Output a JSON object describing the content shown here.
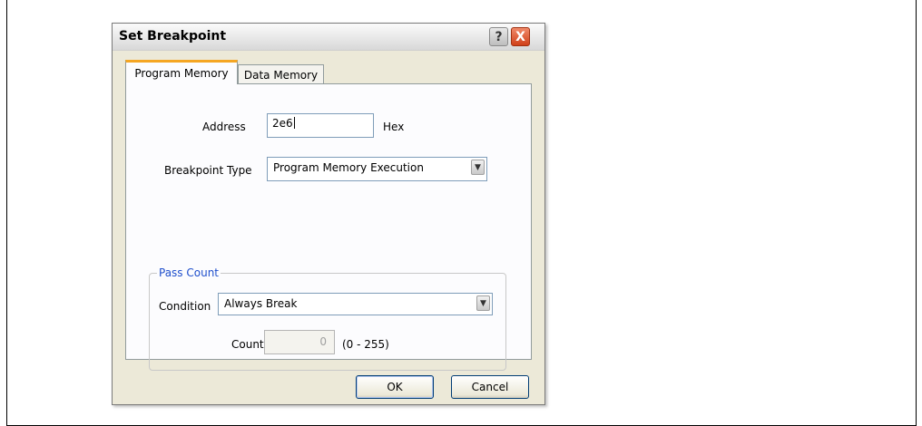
{
  "dialog": {
    "title": "Set Breakpoint",
    "help_glyph": "?",
    "close_glyph": "X"
  },
  "tabs": [
    {
      "label": "Program Memory",
      "active": true
    },
    {
      "label": "Data Memory",
      "active": false
    }
  ],
  "address": {
    "label": "Address",
    "value": "2e6",
    "unit": "Hex"
  },
  "breakpoint_type": {
    "label": "Breakpoint Type",
    "selected": "Program Memory Execution"
  },
  "pass_count": {
    "group_title": "Pass Count",
    "condition_label": "Condition",
    "condition_selected": "Always Break",
    "count_label": "Count",
    "count_value": "0",
    "count_range": "(0 - 255)"
  },
  "buttons": {
    "ok": "OK",
    "cancel": "Cancel"
  },
  "icons": {
    "dropdown": "chevron-down-icon"
  },
  "colors": {
    "dialog_bg": "#ece9d8",
    "active_tab_accent": "#f5a623",
    "group_title": "#1f4fcc",
    "close_button": "#d0401a"
  }
}
